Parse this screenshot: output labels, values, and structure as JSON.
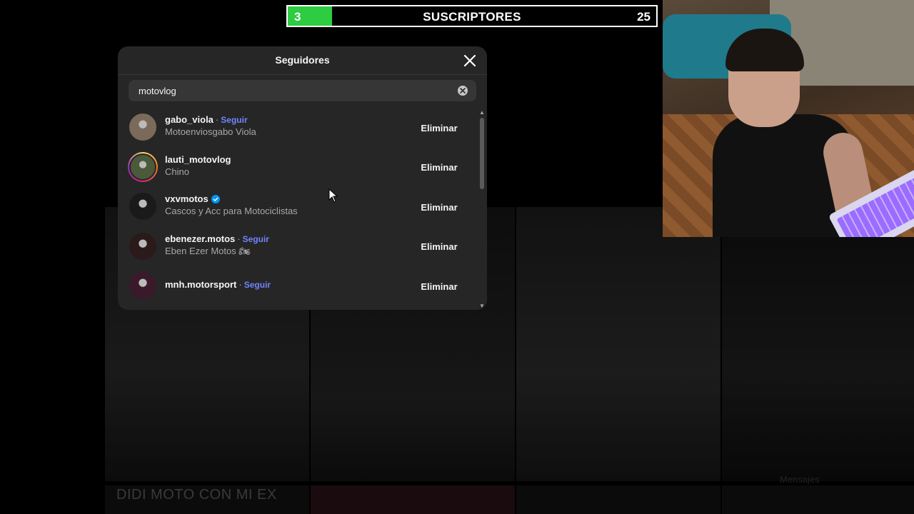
{
  "subscriber_bar": {
    "current": "3",
    "label": "SUSCRIPTORES",
    "goal": "25",
    "progress_fraction": 0.12,
    "fill_color": "#2ecc40"
  },
  "modal": {
    "title": "Seguidores",
    "close_icon": "close-icon",
    "search": {
      "value": "motovlog",
      "clear_icon": "clear-search-icon"
    },
    "remove_label": "Eliminar",
    "followers": [
      {
        "username": "gabo_viola",
        "separator": "·",
        "follow": "Seguir",
        "fullname": "Motoenviosgabo Viola",
        "verified": false,
        "ring": false,
        "avatar_color": "#7a6a5a"
      },
      {
        "username": "lauti_motovlog",
        "separator": "",
        "follow": "",
        "fullname": "Chino",
        "verified": false,
        "ring": true,
        "avatar_color": "#4a5a3a"
      },
      {
        "username": "vxvmotos",
        "separator": "",
        "follow": "",
        "fullname": "Cascos y Acc para Motociclistas",
        "verified": true,
        "ring": false,
        "avatar_color": "#1a1a1a"
      },
      {
        "username": "ebenezer.motos",
        "separator": "·",
        "follow": "Seguir",
        "fullname": "Eben Ezer Motos 🏍",
        "verified": false,
        "ring": false,
        "avatar_color": "#2a1a1a"
      },
      {
        "username": "mnh.motorsport",
        "separator": "·",
        "follow": "Seguir",
        "fullname": "",
        "verified": false,
        "ring": false,
        "avatar_color": "#3a1a2a"
      }
    ]
  },
  "background": {
    "caption": "DIDI MOTO CON MI EX",
    "messages_label": "Mensajes"
  },
  "colors": {
    "modal_bg": "#262626",
    "follow_link": "#7085ff",
    "verified": "#0095f6"
  }
}
